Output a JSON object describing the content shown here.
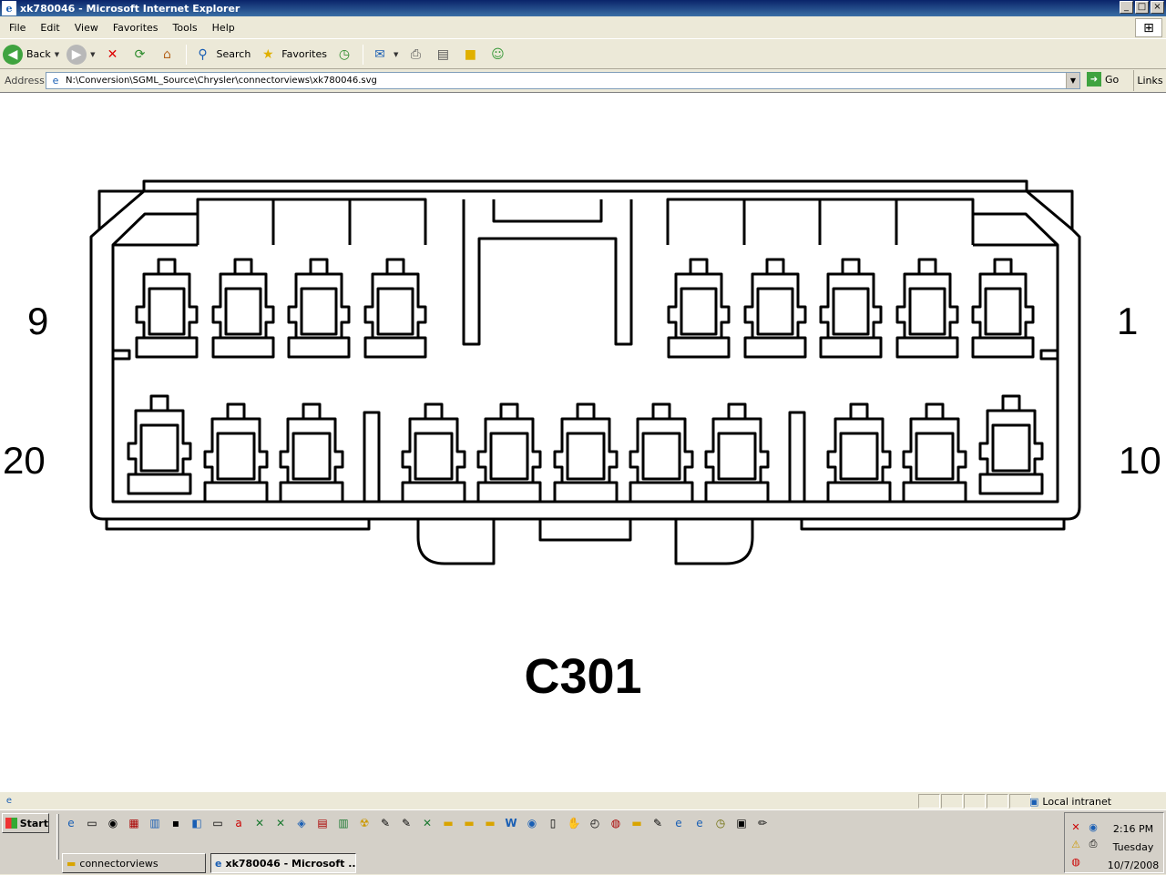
{
  "window": {
    "title": "xk780046 - Microsoft Internet Explorer",
    "icon": "ie-icon",
    "controls": [
      "minimize",
      "maximize",
      "close"
    ]
  },
  "menu": {
    "items": [
      "File",
      "Edit",
      "View",
      "Favorites",
      "Tools",
      "Help"
    ]
  },
  "toolbar": {
    "back_label": "Back",
    "search_label": "Search",
    "favorites_label": "Favorites"
  },
  "address": {
    "label": "Address",
    "value": "N:\\Conversion\\SGML_Source\\Chrysler\\connectorviews\\xk780046.svg",
    "go_label": "Go",
    "links_label": "Links"
  },
  "connector": {
    "name": "C301",
    "pin_labels": {
      "top_left": "9",
      "top_right": "1",
      "bottom_left": "20",
      "bottom_right": "10"
    },
    "top_row_cavities": 9,
    "bottom_row_cavities": 11
  },
  "status": {
    "zone_label": "Local intranet"
  },
  "taskbar": {
    "start_label": "Start",
    "tasks": [
      {
        "label": "connectorviews",
        "icon": "folder-icon",
        "active": false
      },
      {
        "label": "xk780046 - Microsoft ...",
        "icon": "ie-icon",
        "active": true
      }
    ],
    "clock": {
      "time": "2:16 PM",
      "day": "Tuesday",
      "date": "10/7/2008"
    }
  },
  "colors": {
    "title_bar": "#0a246a",
    "chrome": "#ece9d8",
    "content_bg": "#ffffff",
    "drawing_stroke": "#000000"
  }
}
